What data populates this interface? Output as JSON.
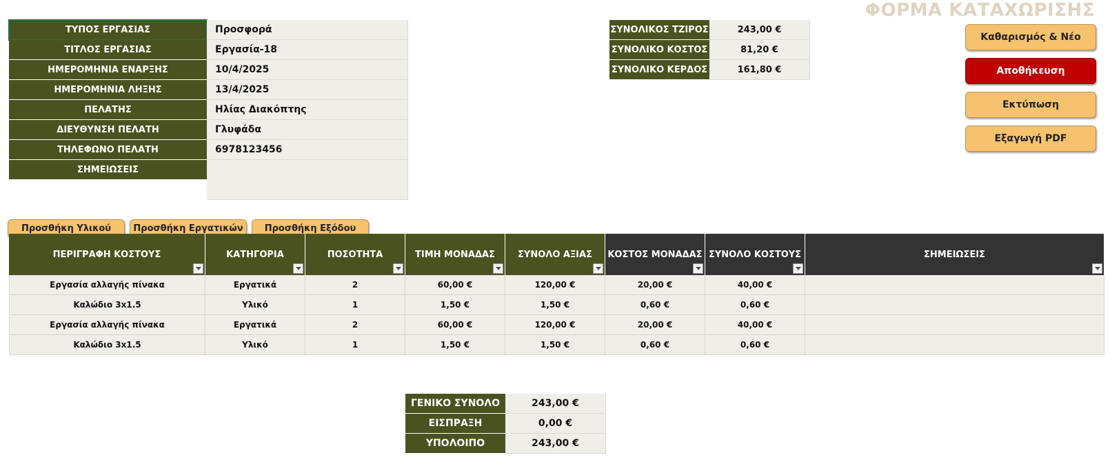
{
  "form_title": "ΦΟΡΜΑ ΚΑΤΑΧΩΡΙΣΗΣ",
  "info": [
    {
      "label": "ΤΥΠΟΣ ΕΡΓΑΣΙΑΣ",
      "value": "Προσφορά"
    },
    {
      "label": "ΤΙΤΛΟΣ ΕΡΓΑΣΙΑΣ",
      "value": "Εργασία-18"
    },
    {
      "label": "ΗΜΕΡΟΜΗΝΙΑ ΕΝΑΡΞΗΣ",
      "value": "10/4/2025"
    },
    {
      "label": "ΗΜΕΡΟΜΗΝΙΑ ΛΗΞΗΣ",
      "value": "13/4/2025"
    },
    {
      "label": "ΠΕΛΑΤΗΣ",
      "value": "Ηλίας Διακόπτης"
    },
    {
      "label": "ΔΙΕΥΘΥΝΣΗ ΠΕΛΑΤΗ",
      "value": "Γλυφάδα"
    },
    {
      "label": "ΤΗΛΕΦΩΝΟ ΠΕΛΑΤΗ",
      "value": "6978123456"
    },
    {
      "label": "ΣΗΜΕΙΩΣΕΙΣ",
      "value": ""
    }
  ],
  "totals": [
    {
      "label": "ΣΥΝΟΛΙΚΟΣ ΤΖΙΡΟΣ",
      "value": "243,00 €"
    },
    {
      "label": "ΣΥΝΟΛΙΚΟ ΚΟΣΤΟΣ",
      "value": "81,20 €"
    },
    {
      "label": "ΣΥΝΟΛΙΚΟ ΚΕΡΔΟΣ",
      "value": "161,80 €"
    }
  ],
  "actions": {
    "clear_new": "Καθαρισμός & Νέο",
    "save": "Αποθήκευση",
    "print": "Εκτύπωση",
    "export_pdf": "Εξαγωγή PDF"
  },
  "add_buttons": {
    "material": "Προσθήκη Υλικού",
    "labor": "Προσθήκη Εργατικών",
    "expense": "Προσθήκη Εξόδου"
  },
  "table": {
    "headers": [
      "ΠΕΡΙΓΡΑΦΗ ΚΟΣΤΟΥΣ",
      "ΚΑΤΗΓΟΡΙΑ",
      "ΠΟΣΟΤΗΤΑ",
      "ΤΙΜΗ ΜΟΝΑΔΑΣ",
      "ΣΥΝΟΛΟ ΑΞΙΑΣ",
      "ΚΟΣΤΟΣ ΜΟΝΑΔΑΣ",
      "ΣΥΝΟΛΟ ΚΟΣΤΟΥΣ",
      "ΣΗΜΕΙΩΣΕΙΣ"
    ],
    "rows": [
      [
        "Εργασία αλλαγής πίνακα",
        "Εργατικά",
        "2",
        "60,00 €",
        "120,00 €",
        "20,00 €",
        "40,00 €",
        ""
      ],
      [
        "Καλώδιο 3x1.5",
        "Υλικό",
        "1",
        "1,50 €",
        "1,50 €",
        "0,60 €",
        "0,60 €",
        ""
      ],
      [
        "Εργασία αλλαγής πίνακα",
        "Εργατικά",
        "2",
        "60,00 €",
        "120,00 €",
        "20,00 €",
        "40,00 €",
        ""
      ],
      [
        "Καλώδιο 3x1.5",
        "Υλικό",
        "1",
        "1,50 €",
        "1,50 €",
        "0,60 €",
        "0,60 €",
        ""
      ]
    ]
  },
  "summary": [
    {
      "label": "ΓΕΝΙΚΟ ΣΥΝΟΛΟ",
      "value": "243,00 €"
    },
    {
      "label": "ΕΙΣΠΡΑΞΗ",
      "value": "0,00 €"
    },
    {
      "label": "ΥΠΟΛΟΙΠΟ",
      "value": "243,00 €"
    }
  ],
  "colors": {
    "olive_header": "#4a5320",
    "dark_header": "#333333",
    "cell_bg": "#f0eee8",
    "button_orange": "#f6c26d",
    "button_red": "#c00000",
    "title_color": "#e0d3c0"
  }
}
